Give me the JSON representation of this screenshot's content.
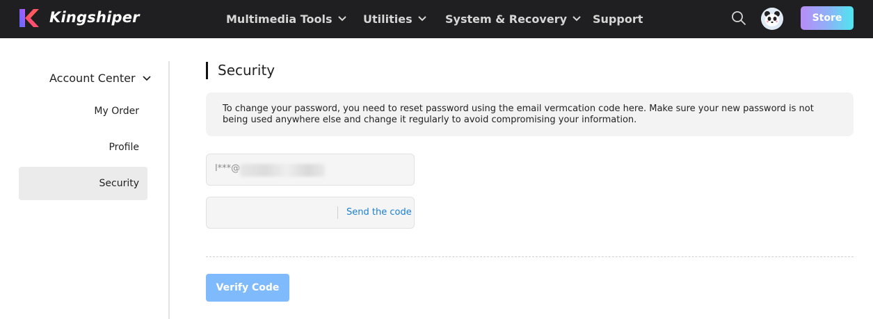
{
  "header": {
    "brand": "Kingshiper",
    "logo_icon": "kingshiper-k-logo",
    "nav": [
      {
        "label": "Multimedia Tools",
        "has_dropdown": true
      },
      {
        "label": "Utilities",
        "has_dropdown": true
      },
      {
        "label": "System & Recovery",
        "has_dropdown": true
      },
      {
        "label": "Support",
        "has_dropdown": false
      }
    ],
    "search_icon": "search-icon",
    "avatar_icon": "panda-avatar",
    "store_label": "Store"
  },
  "sidebar": {
    "section_label": "Account Center",
    "items": [
      {
        "label": "My Order",
        "active": false
      },
      {
        "label": "Profile",
        "active": false
      },
      {
        "label": "Security",
        "active": true
      }
    ]
  },
  "main": {
    "title": "Security",
    "notice": "To change your password, you need to reset password using the email vermcation code here. Make sure your new password is not being used anywhere else and change it regularly to avoid compromising your information.",
    "email_value": "l***@",
    "code_placeholder": "",
    "send_code_label": "Send the code",
    "verify_label": "Verify Code"
  },
  "colors": {
    "header_bg": "#1f1f21",
    "accent_link": "#1a7fd6",
    "verify_button": "#7fbafd",
    "active_sidebar": "#ebebeb"
  }
}
